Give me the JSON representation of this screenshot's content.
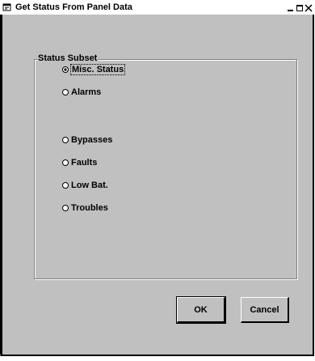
{
  "window": {
    "title": "Get Status From Panel Data",
    "controls": {
      "minimize": "minimize",
      "maximize": "maximize",
      "close": "close"
    }
  },
  "status_subset": {
    "label": "Status Subset",
    "options": [
      {
        "label": "Misc. Status",
        "selected": true
      },
      {
        "label": "Alarms",
        "selected": false
      },
      {
        "label": "Bypasses",
        "selected": false
      },
      {
        "label": "Faults",
        "selected": false
      },
      {
        "label": "Low Bat.",
        "selected": false
      },
      {
        "label": "Troubles",
        "selected": false
      }
    ]
  },
  "buttons": {
    "ok": "OK",
    "cancel": "Cancel"
  },
  "icons": {
    "app": "window-app-icon"
  }
}
